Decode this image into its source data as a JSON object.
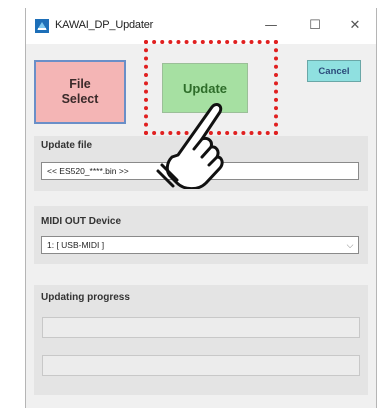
{
  "window": {
    "title": "KAWAI_DP_Updater",
    "minimize_symbol": "—",
    "maximize_symbol": "☐",
    "close_symbol": "✕"
  },
  "buttons": {
    "file_select_line1": "File",
    "file_select_line2": "Select",
    "update_label": "Update",
    "cancel_label": "Cancel"
  },
  "update_file": {
    "label": "Update file",
    "value": "<< ES520_****.bin >>"
  },
  "midi_out": {
    "label": "MIDI OUT Device",
    "selected": "1: [ USB-MIDI ]"
  },
  "progress": {
    "label": "Updating progress",
    "bar1_level": 0,
    "bar2_level": 0
  },
  "colors": {
    "file_select_bg": "#f4b5b5",
    "update_bg": "#a6e0a2",
    "cancel_bg": "#8fe0e0",
    "highlight": "#e02020"
  },
  "icons": {
    "app": "kawai-app-icon",
    "pointer": "pointing-hand-icon"
  }
}
